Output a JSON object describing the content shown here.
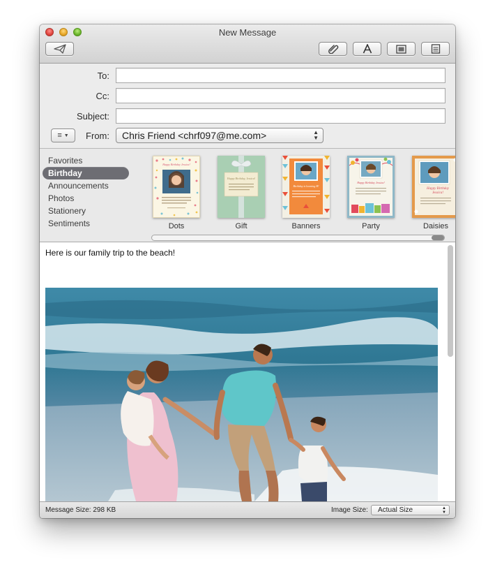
{
  "window": {
    "title": "New Message"
  },
  "toolbar": {
    "send_icon": "paper-plane-icon",
    "attach_icon": "paperclip-icon",
    "fonts_icon": "letter-a-icon",
    "photo_browser_icon": "photo-icon",
    "stationery_icon": "stationery-icon"
  },
  "headers": {
    "to_label": "To:",
    "to_value": "",
    "cc_label": "Cc:",
    "cc_value": "",
    "subject_label": "Subject:",
    "subject_value": "",
    "from_label": "From:",
    "from_value": "Chris Friend <chrf097@me.com>"
  },
  "stationery": {
    "categories": [
      "Favorites",
      "Birthday",
      "Announcements",
      "Photos",
      "Stationery",
      "Sentiments"
    ],
    "selected_category": "Birthday",
    "templates": [
      {
        "name": "Dots"
      },
      {
        "name": "Gift"
      },
      {
        "name": "Banners"
      },
      {
        "name": "Party"
      },
      {
        "name": "Daisies"
      }
    ],
    "thumb_text": {
      "dots_title": "Happy Birthday Jessica!",
      "gift_title": "Happy Birthday, Jessica!",
      "banners_title": "Birthday is looming H!",
      "party_title": "Happy Birthday Jessica!",
      "daisies_title": "Happy Birthday Jessica!"
    }
  },
  "message": {
    "body_text": "Here is our family trip to the beach!"
  },
  "statusbar": {
    "message_size_label": "Message Size: 298 KB",
    "image_size_label": "Image Size:",
    "image_size_value": "Actual Size"
  }
}
